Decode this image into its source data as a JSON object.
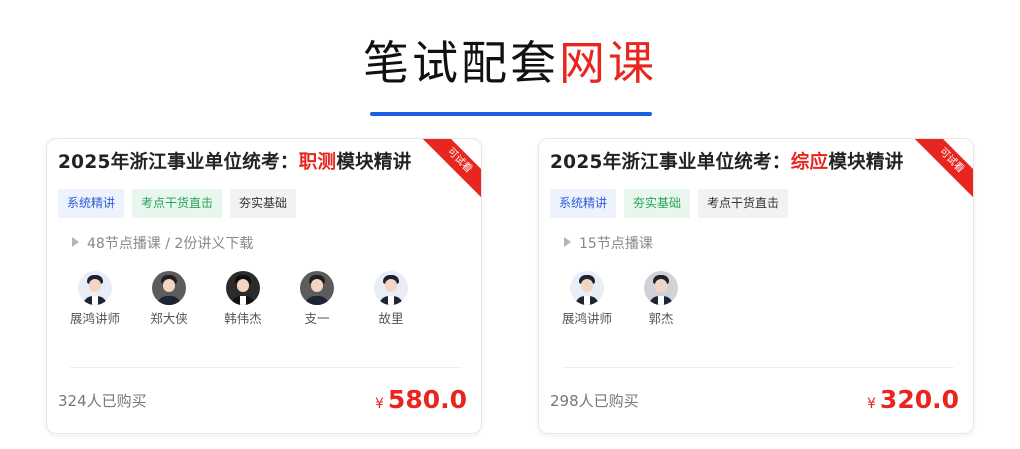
{
  "section": {
    "title_main": "笔试配套",
    "title_highlight": "网课",
    "underline_color": "#1a5fe6"
  },
  "courses": [
    {
      "ribbon": "可试看",
      "title_prefix": "2025年浙江事业单位统考：",
      "title_highlight": "职测",
      "title_suffix": "模块精讲",
      "tags": [
        {
          "label": "系统精讲",
          "style": "blue"
        },
        {
          "label": "考点干货直击",
          "style": "green"
        },
        {
          "label": "夯实基础",
          "style": "gray"
        }
      ],
      "lessons": "48节点播课 / 2份讲义下载",
      "teachers": [
        {
          "name": "展鸿讲师",
          "avatar": "male-teacher-avatar"
        },
        {
          "name": "郑大侠",
          "avatar": "female-teacher-avatar"
        },
        {
          "name": "韩伟杰",
          "avatar": "male-teacher-avatar"
        },
        {
          "name": "支一",
          "avatar": "female-teacher-avatar"
        },
        {
          "name": "故里",
          "avatar": "male-teacher-avatar"
        }
      ],
      "buyers": "324人已购买",
      "currency": "¥",
      "price": "580.0"
    },
    {
      "ribbon": "可试看",
      "title_prefix": "2025年浙江事业单位统考：",
      "title_highlight": "综应",
      "title_suffix": "模块精讲",
      "tags": [
        {
          "label": "系统精讲",
          "style": "blue"
        },
        {
          "label": "夯实基础",
          "style": "green"
        },
        {
          "label": "考点干货直击",
          "style": "gray"
        }
      ],
      "lessons": "15节点播课",
      "teachers": [
        {
          "name": "展鸿讲师",
          "avatar": "male-teacher-avatar"
        },
        {
          "name": "郭杰",
          "avatar": "male-teacher-avatar"
        }
      ],
      "buyers": "298人已购买",
      "currency": "¥",
      "price": "320.0"
    }
  ],
  "colors": {
    "accent_red": "#e8261f",
    "tag_blue": "#2e5ed6",
    "tag_green": "#2aa35a"
  }
}
